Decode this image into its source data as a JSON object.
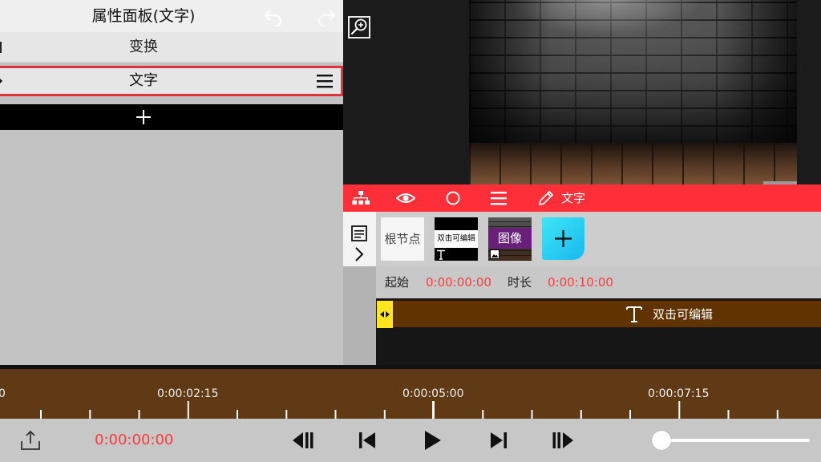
{
  "panel": {
    "title": "属性面板(文字)",
    "rows": [
      {
        "label": "变换"
      },
      {
        "label": "文字",
        "selected": true
      }
    ],
    "add_icon": "plus-icon",
    "undo_icon": "undo-icon",
    "redo_icon": "redo-icon"
  },
  "preview": {
    "zoom_icon": "zoom-in-icon"
  },
  "toolbar": {
    "icons": [
      "hierarchy-icon",
      "eye-icon",
      "circle-icon",
      "menu-icon",
      "pencil-icon"
    ],
    "text_label": "文字",
    "background": "#ff2f3a"
  },
  "nodes": {
    "root_label": "根节点",
    "text_node_label": "双击可编辑",
    "image_node_label": "图像",
    "add_icon": "plus-icon"
  },
  "info": {
    "start_label": "起始",
    "start_value": "0:00:00:00",
    "duration_label": "时长",
    "duration_value": "0:00:10:00"
  },
  "clip": {
    "label": "双击可编辑",
    "color": "#613300",
    "handle_color": "#ffe51f"
  },
  "ruler": {
    "labels": [
      "0",
      "0:00:02:15",
      "0:00:05:00",
      "0:00:07:15"
    ]
  },
  "playback": {
    "current_time": "0:00:00:00",
    "buttons": [
      "rewind-icon",
      "previous-icon",
      "play-icon",
      "next-icon",
      "fast-forward-icon"
    ],
    "share_icon": "share-icon",
    "accent_time_color": "#ff3b3b",
    "volume_level": 0.0
  }
}
